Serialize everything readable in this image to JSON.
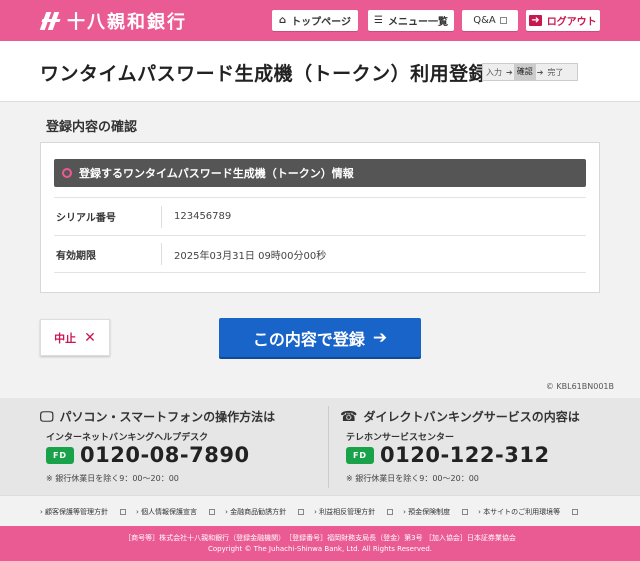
{
  "header": {
    "bank_name": "十八親和銀行",
    "top_page": "トップページ",
    "menu": "メニュー一覧",
    "qa": "Q&A",
    "logout": "ログアウト"
  },
  "title_band": {
    "title": "ワンタイムパスワード生成機（トークン）利用登録",
    "steps": [
      "入力",
      "確認",
      "完了"
    ],
    "current_step": "確認"
  },
  "confirm": {
    "section_title": "登録内容の確認",
    "panel_title": "登録するワンタイムパスワード生成機（トークン）情報",
    "rows": [
      {
        "label": "シリアル番号",
        "value": "123456789"
      },
      {
        "label": "有効期限",
        "value": "2025年03月31日 09時00分00秒"
      }
    ]
  },
  "buttons": {
    "cancel": "中止",
    "cancel_icon": "✕",
    "submit": "この内容で登録",
    "submit_icon": "➔"
  },
  "screen_id": "© KBL61BN001B",
  "help": {
    "pc": {
      "title": "パソコン・スマートフォンの操作方法は",
      "desk": "インターネットバンキングヘルプデスク",
      "tel": "0120-08-7890",
      "note": "※ 銀行休業日を除く9：00～20：00"
    },
    "phone": {
      "title": "ダイレクトバンキングサービスの内容は",
      "desk": "テレホンサービスセンター",
      "tel": "0120-122-312",
      "note": "※ 銀行休業日を除く9：00～20：00"
    }
  },
  "footer_links": [
    "顧客保護等管理方針",
    "個人情報保護宣言",
    "金融商品勧誘方針",
    "利益相反管理方針",
    "預金保険制度",
    "本サイトのご利用環境等"
  ],
  "footer": {
    "line1": "［商号等］株式会社十八親和銀行（登録金融機関）　［登録番号］福岡財務支局長（登金）第3号 ［加入協会］日本証券業協会",
    "line2": "Copyright © The Juhachi-Shinwa Bank, Ltd. All Rights Reserved."
  },
  "colors": {
    "brand_pink": "#ea5b93",
    "primary_blue": "#1964c8",
    "free_dial_green": "#19a24a"
  }
}
